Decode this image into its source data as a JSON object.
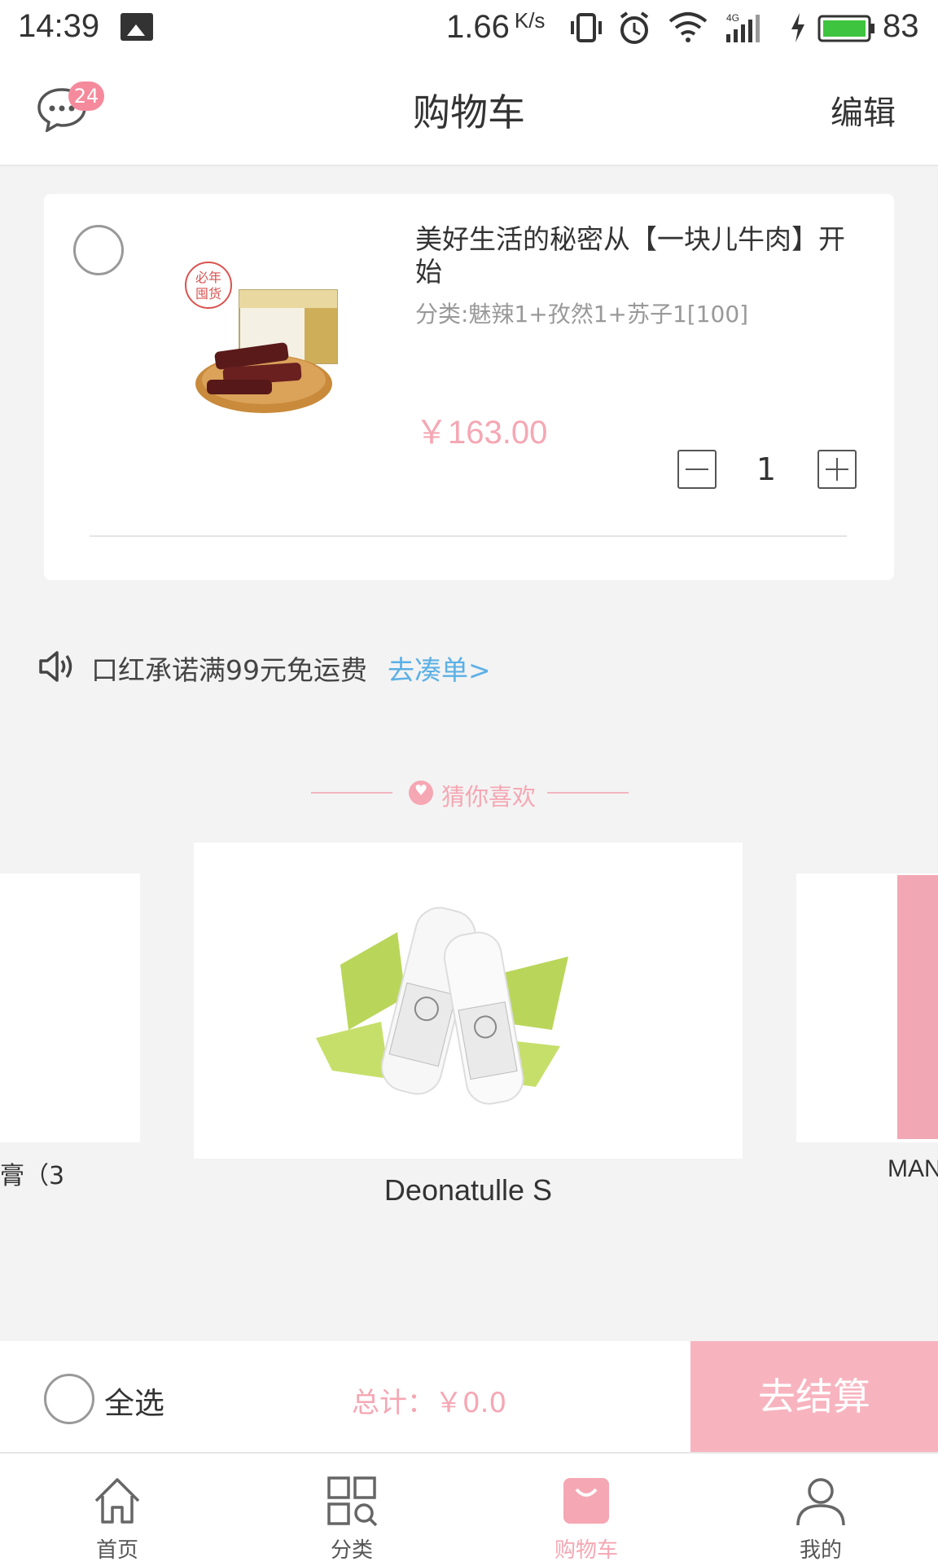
{
  "status_bar": {
    "time": "14:39",
    "speed": "1.66",
    "speed_unit": "K/s",
    "battery": "83",
    "icons": [
      "image-icon",
      "vibrate-icon",
      "alarm-icon",
      "wifi-icon",
      "signal-4g-icon",
      "charging-icon",
      "battery-icon"
    ]
  },
  "header": {
    "title": "购物车",
    "edit_label": "编辑",
    "message_badge": "24"
  },
  "cart_item": {
    "title": "美好生活的秘密从【一块儿牛肉】开始",
    "spec": "分类:魅辣1+孜然1+苏子1[100]",
    "price": "￥163.00",
    "quantity": "1",
    "image_badge": "年货必囤"
  },
  "promo": {
    "text": "口红承诺满99元免运费",
    "link": "去凑单>"
  },
  "recommend": {
    "title": "猜你喜欢",
    "items": [
      {
        "name": "膏（3"
      },
      {
        "name": "Deonatulle S"
      },
      {
        "name": "MAN"
      }
    ]
  },
  "checkout": {
    "select_all_label": "全选",
    "total_label": "总计：￥0.0",
    "checkout_label": "去结算"
  },
  "tabbar": {
    "tabs": [
      {
        "label": "首页",
        "icon": "home-icon"
      },
      {
        "label": "分类",
        "icon": "category-icon"
      },
      {
        "label": "购物车",
        "icon": "cart-bag-icon",
        "active": true
      },
      {
        "label": "我的",
        "icon": "profile-icon"
      }
    ]
  },
  "colors": {
    "accent": "#f5a7b3",
    "checkout_button": "#f7b4bf",
    "link": "#5bb0e6",
    "background": "#f3f3f3"
  }
}
